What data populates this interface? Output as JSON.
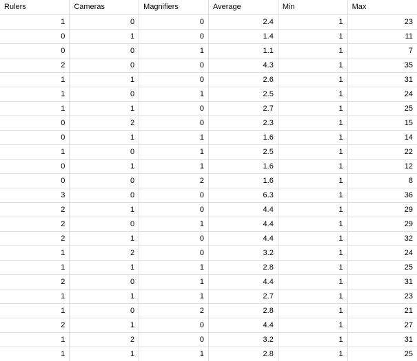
{
  "table": {
    "headers": [
      "Rulers",
      "Cameras",
      "Magnifiers",
      "Average",
      "Min",
      "Max"
    ],
    "rows": [
      [
        "1",
        "0",
        "0",
        "2.4",
        "1",
        "23"
      ],
      [
        "0",
        "1",
        "0",
        "1.4",
        "1",
        "11"
      ],
      [
        "0",
        "0",
        "1",
        "1.1",
        "1",
        "7"
      ],
      [
        "2",
        "0",
        "0",
        "4.3",
        "1",
        "35"
      ],
      [
        "1",
        "1",
        "0",
        "2.6",
        "1",
        "31"
      ],
      [
        "1",
        "0",
        "1",
        "2.5",
        "1",
        "24"
      ],
      [
        "1",
        "1",
        "0",
        "2.7",
        "1",
        "25"
      ],
      [
        "0",
        "2",
        "0",
        "2.3",
        "1",
        "15"
      ],
      [
        "0",
        "1",
        "1",
        "1.6",
        "1",
        "14"
      ],
      [
        "1",
        "0",
        "1",
        "2.5",
        "1",
        "22"
      ],
      [
        "0",
        "1",
        "1",
        "1.6",
        "1",
        "12"
      ],
      [
        "0",
        "0",
        "2",
        "1.6",
        "1",
        "8"
      ],
      [
        "3",
        "0",
        "0",
        "6.3",
        "1",
        "36"
      ],
      [
        "2",
        "1",
        "0",
        "4.4",
        "1",
        "29"
      ],
      [
        "2",
        "0",
        "1",
        "4.4",
        "1",
        "29"
      ],
      [
        "2",
        "1",
        "0",
        "4.4",
        "1",
        "32"
      ],
      [
        "1",
        "2",
        "0",
        "3.2",
        "1",
        "24"
      ],
      [
        "1",
        "1",
        "1",
        "2.8",
        "1",
        "25"
      ],
      [
        "2",
        "0",
        "1",
        "4.4",
        "1",
        "31"
      ],
      [
        "1",
        "1",
        "1",
        "2.7",
        "1",
        "23"
      ],
      [
        "1",
        "0",
        "2",
        "2.8",
        "1",
        "21"
      ],
      [
        "2",
        "1",
        "0",
        "4.4",
        "1",
        "27"
      ],
      [
        "1",
        "2",
        "0",
        "3.2",
        "1",
        "31"
      ],
      [
        "1",
        "1",
        "1",
        "2.8",
        "1",
        "25"
      ]
    ]
  }
}
